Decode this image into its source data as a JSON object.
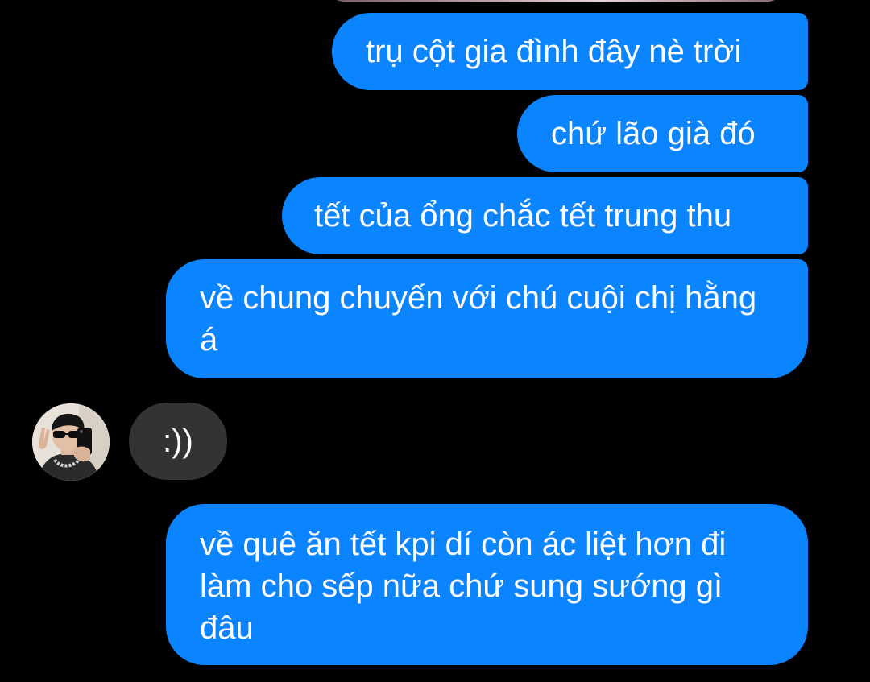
{
  "conversation": {
    "messages": [
      {
        "id": "b1",
        "direction": "outgoing",
        "text": "trụ cột gia đình đây nè trời"
      },
      {
        "id": "b2",
        "direction": "outgoing",
        "text": "chứ lão già đó"
      },
      {
        "id": "b3",
        "direction": "outgoing",
        "text": "tết của ổng chắc tết trung thu"
      },
      {
        "id": "b4",
        "direction": "outgoing",
        "text": "về chung chuyến với chú cuội chị hằng á"
      },
      {
        "id": "b6",
        "direction": "incoming",
        "text": ":))"
      },
      {
        "id": "b5",
        "direction": "outgoing",
        "text": "về quê ăn tết kpi dí còn ác liệt hơn đi làm cho sếp nữa chứ sung sướng gì đâu"
      }
    ]
  },
  "theme": {
    "background": "#000000",
    "outgoing_bubble": "#0a84ff",
    "incoming_bubble": "#333333",
    "text": "#ffffff"
  },
  "icons": {
    "contact_avatar": "avatar-photo-icon"
  }
}
